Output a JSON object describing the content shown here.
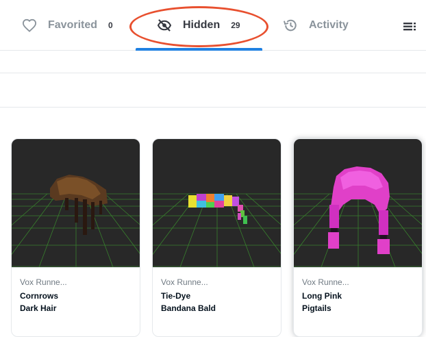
{
  "tabs": [
    {
      "label": "Favorited",
      "count": "0",
      "icon": "heart-icon"
    },
    {
      "label": "Hidden",
      "count": "29",
      "icon": "eye-off-icon"
    },
    {
      "label": "Activity",
      "icon": "history-icon"
    }
  ],
  "colors": {
    "accent": "#2081e2",
    "annotation": "#e8502f",
    "grid": "#3a8a2e"
  },
  "cards": [
    {
      "collection": "Vox Runne...",
      "name_line1": "Cornrows",
      "name_line2": "Dark Hair"
    },
    {
      "collection": "Vox Runne...",
      "name_line1": "Tie-Dye",
      "name_line2": "Bandana Bald"
    },
    {
      "collection": "Vox Runne...",
      "name_line1": "Long Pink",
      "name_line2": "Pigtails"
    }
  ]
}
